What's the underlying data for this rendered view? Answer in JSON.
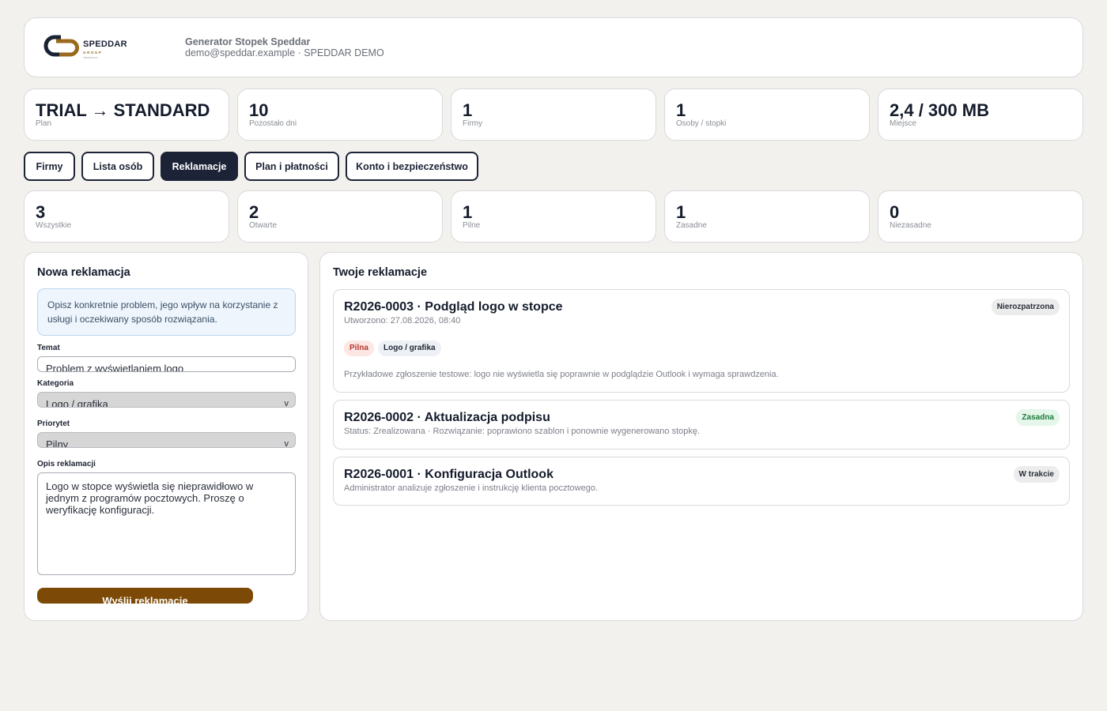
{
  "header": {
    "logo_text": "SPEDDAR",
    "logo_sub": "GROUP",
    "logo_sub2": "SPEDDAR.PL",
    "title": "Generator Stopek Speddar",
    "subtitle": "demo@speddar.example · SPEDDAR DEMO",
    "brand_color": "#9a6a1c"
  },
  "account_stats": [
    {
      "value": "TRIAL → STANDARD",
      "label": "Plan"
    },
    {
      "value": "10",
      "label": "Pozostało dni"
    },
    {
      "value": "1",
      "label": "Firmy"
    },
    {
      "value": "1",
      "label": "Osoby / stopki"
    },
    {
      "value": "2,4 / 300 MB",
      "label": "Miejsce"
    }
  ],
  "tabs": [
    {
      "label": "Firmy",
      "active": false
    },
    {
      "label": "Lista osób",
      "active": false
    },
    {
      "label": "Reklamacje",
      "active": true
    },
    {
      "label": "Plan i płatności",
      "active": false
    },
    {
      "label": "Konto i bezpieczeństwo",
      "active": false
    }
  ],
  "complaint_stats": [
    {
      "value": "3",
      "label": "Wszystkie"
    },
    {
      "value": "2",
      "label": "Otwarte"
    },
    {
      "value": "1",
      "label": "Pilne"
    },
    {
      "value": "1",
      "label": "Zasadne"
    },
    {
      "value": "0",
      "label": "Niezasadne"
    }
  ],
  "form": {
    "title": "Nowa reklamacja",
    "info": "Opisz konkretnie problem, jego wpływ na korzystanie z usługi i oczekiwany sposób rozwiązania.",
    "subject_label": "Temat",
    "subject_value": "Problem z wyświetlaniem logo",
    "category_label": "Kategoria",
    "category_value": "Logo / grafika",
    "priority_label": "Priorytet",
    "priority_value": "Pilny",
    "description_label": "Opis reklamacji",
    "description_value": "Logo w stopce wyświetla się nieprawidłowo w jednym z programów pocztowych. Proszę o weryfikację konfiguracji.",
    "submit_label": "Wyślij reklamację",
    "chevron": "v",
    "accent_color": "#7c4a06"
  },
  "tickets": {
    "title": "Twoje reklamacje",
    "items": [
      {
        "title": "R2026-0003 · Podgląd logo w stopce",
        "subtitle": "Utworzono: 27.08.2026, 08:40",
        "status": "Nierozpatrzona",
        "tags": [
          "Pilna",
          "Logo / grafika"
        ],
        "description": "Przykładowe zgłoszenie testowe: logo nie wyświetla się poprawnie w podglądzie Outlook i wymaga sprawdzenia."
      },
      {
        "title": "R2026-0002 · Aktualizacja podpisu",
        "subtitle": "Status: Zrealizowana · Rozwiązanie: poprawiono szablon i ponownie wygenerowano stopkę.",
        "status": "Zasadna"
      },
      {
        "title": "R2026-0001 · Konfiguracja Outlook",
        "subtitle": "Administrator analizuje zgłoszenie i instrukcję klienta pocztowego.",
        "status": "W trakcie"
      }
    ]
  }
}
